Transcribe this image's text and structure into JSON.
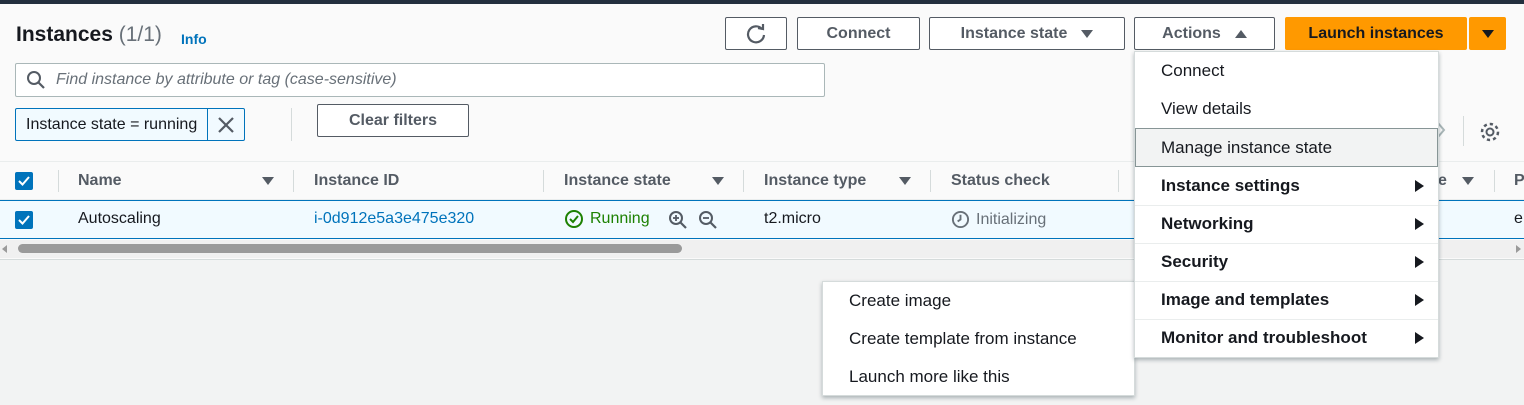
{
  "header": {
    "title": "Instances",
    "count": "(1/1)",
    "info_link": "Info"
  },
  "toolbar": {
    "refresh_icon": "refresh-icon",
    "connect_label": "Connect",
    "instance_state_label": "Instance state",
    "actions_label": "Actions",
    "launch_label": "Launch instances"
  },
  "search": {
    "placeholder": "Find instance by attribute or tag (case-sensitive)"
  },
  "filters": {
    "token": "Instance state = running",
    "clear_label": "Clear filters"
  },
  "table": {
    "columns": [
      "Name",
      "Instance ID",
      "Instance state",
      "Instance type",
      "Status check"
    ],
    "partial_columns": [
      "e",
      "P"
    ],
    "rows": [
      {
        "name": "Autoscaling",
        "instance_id": "i-0d912e5a3e475e320",
        "instance_state": "Running",
        "instance_type": "t2.micro",
        "status_check": "Initializing",
        "partial": "e"
      }
    ]
  },
  "actions_menu": {
    "items": [
      {
        "label": "Connect",
        "bold": false,
        "submenu": false
      },
      {
        "label": "View details",
        "bold": false,
        "submenu": false
      },
      {
        "label": "Manage instance state",
        "bold": false,
        "submenu": false,
        "hover": true
      },
      {
        "label": "Instance settings",
        "bold": true,
        "submenu": true
      },
      {
        "label": "Networking",
        "bold": true,
        "submenu": true
      },
      {
        "label": "Security",
        "bold": true,
        "submenu": true
      },
      {
        "label": "Image and templates",
        "bold": true,
        "submenu": true
      },
      {
        "label": "Monitor and troubleshoot",
        "bold": true,
        "submenu": true
      }
    ]
  },
  "image_submenu": {
    "items": [
      "Create image",
      "Create template from instance",
      "Launch more like this"
    ]
  },
  "colors": {
    "accent": "#0073bb",
    "orange": "#ff9900",
    "running": "#1d8102"
  }
}
